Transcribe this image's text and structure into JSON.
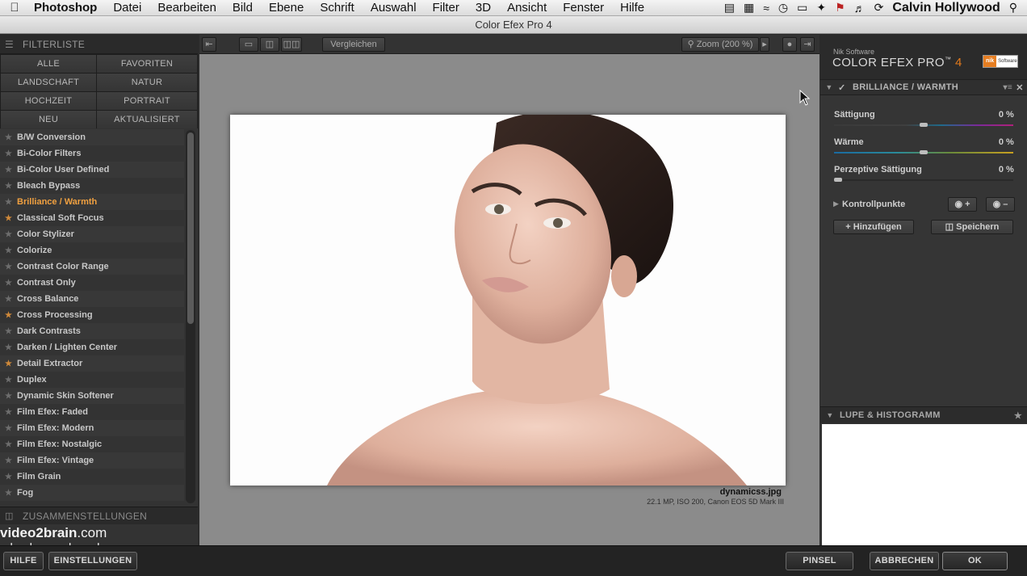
{
  "menubar": {
    "app_name": "Photoshop",
    "menus": [
      "Datei",
      "Bearbeiten",
      "Bild",
      "Ebene",
      "Schrift",
      "Auswahl",
      "Filter",
      "3D",
      "Ansicht",
      "Fenster",
      "Hilfe"
    ],
    "user": "Calvin Hollywood"
  },
  "window": {
    "title": "Color Efex Pro 4"
  },
  "left_panel": {
    "header": "FILTERLISTE",
    "categories": [
      "ALLE",
      "FAVORITEN",
      "LANDSCHAFT",
      "NATUR",
      "HOCHZEIT",
      "PORTRAIT",
      "NEU",
      "AKTUALISIERT"
    ],
    "filters": [
      {
        "name": "B/W Conversion",
        "favorite": false
      },
      {
        "name": "Bi-Color Filters",
        "favorite": false
      },
      {
        "name": "Bi-Color User Defined",
        "favorite": false
      },
      {
        "name": "Bleach Bypass",
        "favorite": false
      },
      {
        "name": "Brilliance / Warmth",
        "favorite": false,
        "active": true
      },
      {
        "name": "Classical Soft Focus",
        "favorite": true
      },
      {
        "name": "Color Stylizer",
        "favorite": false
      },
      {
        "name": "Colorize",
        "favorite": false
      },
      {
        "name": "Contrast Color Range",
        "favorite": false
      },
      {
        "name": "Contrast Only",
        "favorite": false
      },
      {
        "name": "Cross Balance",
        "favorite": false
      },
      {
        "name": "Cross Processing",
        "favorite": true
      },
      {
        "name": "Dark Contrasts",
        "favorite": false
      },
      {
        "name": "Darken / Lighten Center",
        "favorite": false
      },
      {
        "name": "Detail Extractor",
        "favorite": true
      },
      {
        "name": "Duplex",
        "favorite": false
      },
      {
        "name": "Dynamic Skin Softener",
        "favorite": false
      },
      {
        "name": "Film Efex: Faded",
        "favorite": false
      },
      {
        "name": "Film Efex: Modern",
        "favorite": false
      },
      {
        "name": "Film Efex: Nostalgic",
        "favorite": false
      },
      {
        "name": "Film Efex: Vintage",
        "favorite": false
      },
      {
        "name": "Film Grain",
        "favorite": false
      },
      {
        "name": "Fog",
        "favorite": false
      }
    ],
    "sets_header": "ZUSAMMENSTELLUNGEN",
    "watermark_line1_bold": "video2brain",
    "watermark_line1_rest": ".com",
    "watermark_line2": "a lynda.com brand"
  },
  "toolbar": {
    "compare_label": "Vergleichen",
    "zoom_label": "Zoom (200 %)"
  },
  "image": {
    "file_name": "dynamicss.jpg",
    "file_info": "22.1 MP, ISO 200, Canon EOS 5D Mark III"
  },
  "right_panel": {
    "brand_small": "Nik Software",
    "brand_name": "COLOR EFEX PRO",
    "brand_tm": "™",
    "brand_version": "4",
    "logo_text": "nik",
    "logo_sub": "Software",
    "filter_title": "BRILLIANCE / WARMTH",
    "sliders": [
      {
        "label": "Sättigung",
        "value": "0",
        "unit": "%",
        "level": 0.5
      },
      {
        "label": "Wärme",
        "value": "0",
        "unit": "%",
        "level": 0.5
      },
      {
        "label": "Perzeptive Sättigung",
        "value": "0",
        "unit": "%",
        "level": 0.0
      }
    ],
    "control_points_label": "Kontrollpunkte",
    "add_label": "Hinzufügen",
    "save_label": "Speichern",
    "loupe_header": "LUPE & HISTOGRAMM"
  },
  "bottom_bar": {
    "help": "HILFE",
    "settings": "EINSTELLUNGEN",
    "brush": "PINSEL",
    "cancel": "ABBRECHEN",
    "ok": "OK"
  }
}
